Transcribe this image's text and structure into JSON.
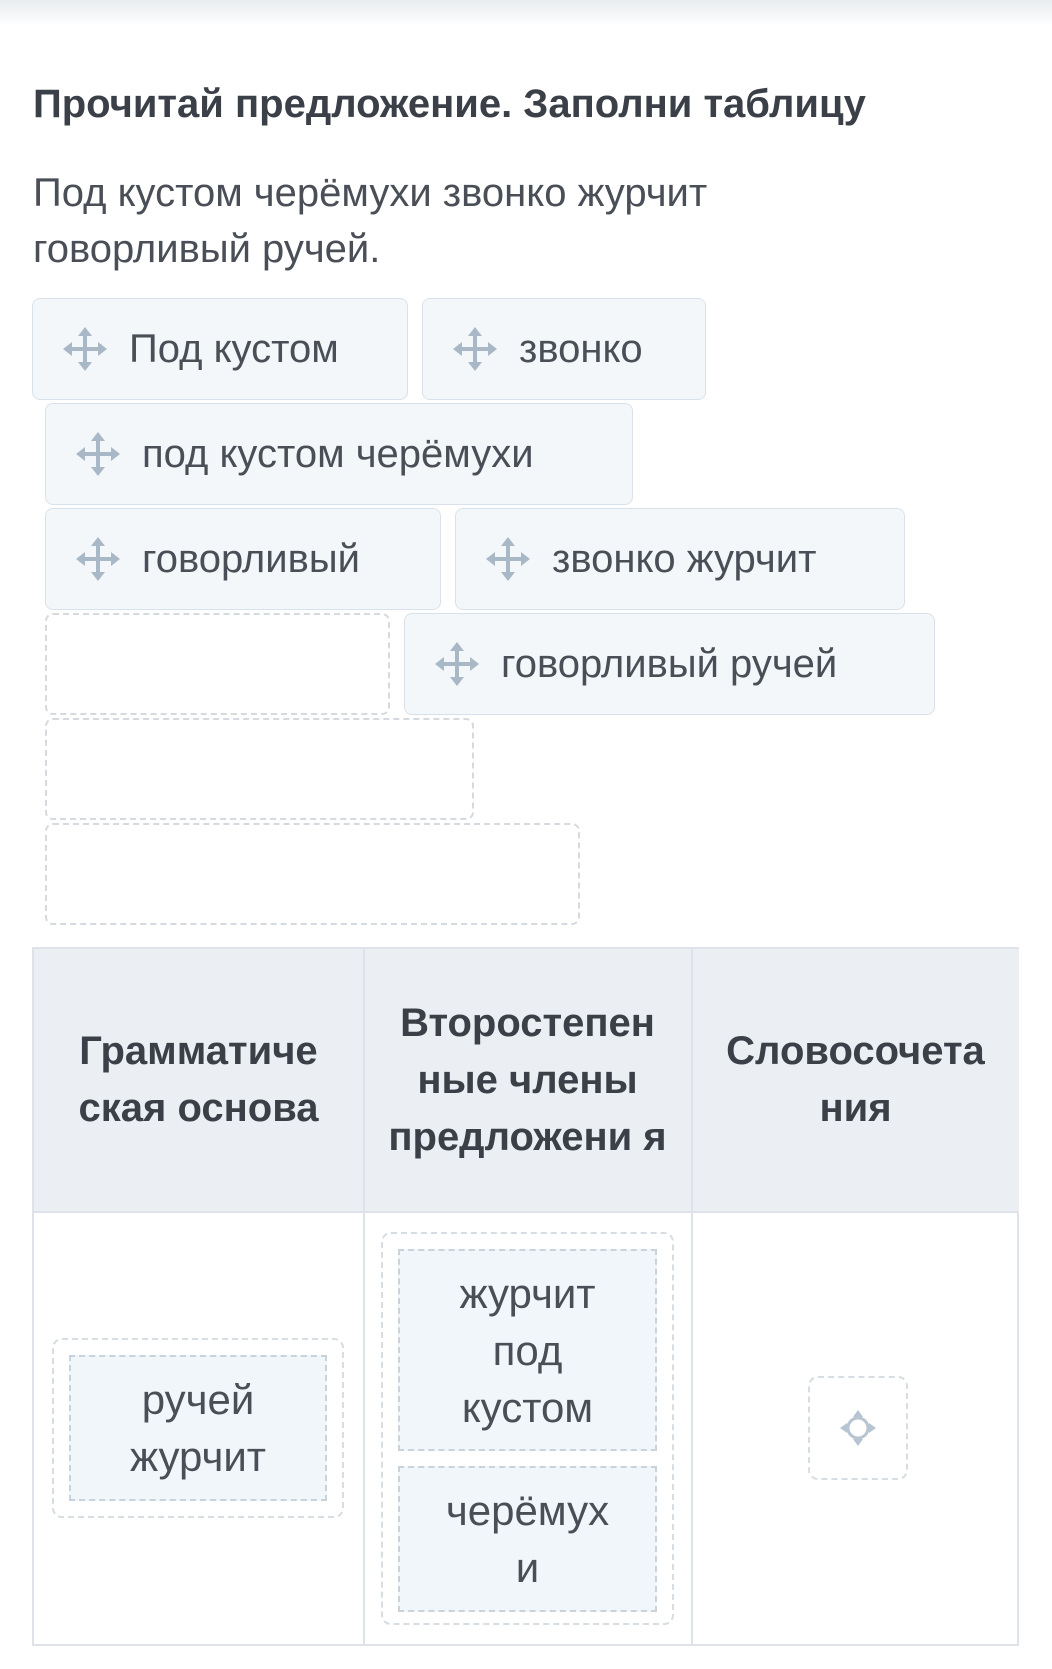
{
  "task": {
    "title": "Прочитай предложение. Заполни таблицу",
    "sentence": "Под кустом черёмухи звонко журчит говорливый ручей."
  },
  "chips": [
    {
      "label": "Под кустом",
      "icon": "move-icon"
    },
    {
      "label": "звонко",
      "icon": "move-icon"
    },
    {
      "label": "под кустом черёмухи",
      "icon": "move-icon"
    },
    {
      "label": "говорливый",
      "icon": "move-icon"
    },
    {
      "label": "звонко журчит",
      "icon": "move-icon"
    },
    {
      "label": "говорливый ручей",
      "icon": "move-icon"
    }
  ],
  "table": {
    "headers": [
      "Грамматиче ская основа",
      "Второстепен ные члены предложени я",
      "Словосочета ния"
    ],
    "cells": {
      "col1": [
        "ручей журчит"
      ],
      "col2": [
        "журчит под кустом",
        "черёмух и"
      ],
      "col3_icon": "target-icon"
    }
  },
  "colors": {
    "chip_bg": "#f3f7fa",
    "header_bg": "#ebeff3",
    "text": "#3b4048",
    "icon": "#a9b8c6"
  }
}
